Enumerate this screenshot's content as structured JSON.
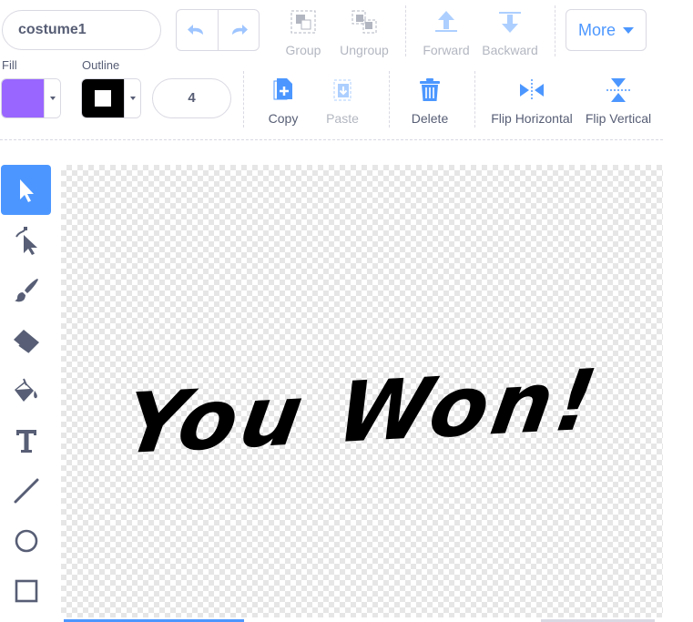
{
  "costume": {
    "name": "costume1"
  },
  "toolbar": {
    "group_label": "Group",
    "ungroup_label": "Ungroup",
    "forward_label": "Forward",
    "backward_label": "Backward",
    "more_label": "More",
    "copy_label": "Copy",
    "paste_label": "Paste",
    "delete_label": "Delete",
    "flip_horizontal_label": "Flip Horizontal",
    "flip_vertical_label": "Flip Vertical"
  },
  "style": {
    "fill_label": "Fill",
    "outline_label": "Outline",
    "fill_color": "#9966ff",
    "outline_color": "#000000",
    "outline_width": "4"
  },
  "tools": [
    {
      "name": "select-tool",
      "icon": "arrow-icon",
      "selected": true
    },
    {
      "name": "reshape-tool",
      "icon": "reshape-icon",
      "selected": false
    },
    {
      "name": "brush-tool",
      "icon": "brush-icon",
      "selected": false
    },
    {
      "name": "eraser-tool",
      "icon": "eraser-icon",
      "selected": false
    },
    {
      "name": "fill-tool",
      "icon": "bucket-icon",
      "selected": false
    },
    {
      "name": "text-tool",
      "icon": "text-icon",
      "selected": false
    },
    {
      "name": "line-tool",
      "icon": "line-icon",
      "selected": false
    },
    {
      "name": "circle-tool",
      "icon": "circle-icon",
      "selected": false
    },
    {
      "name": "rectangle-tool",
      "icon": "rectangle-icon",
      "selected": false
    }
  ],
  "canvas": {
    "text": "You Won!"
  },
  "colors": {
    "accent": "#4c97ff",
    "text": "#575e75",
    "border": "#d9d9e3"
  }
}
